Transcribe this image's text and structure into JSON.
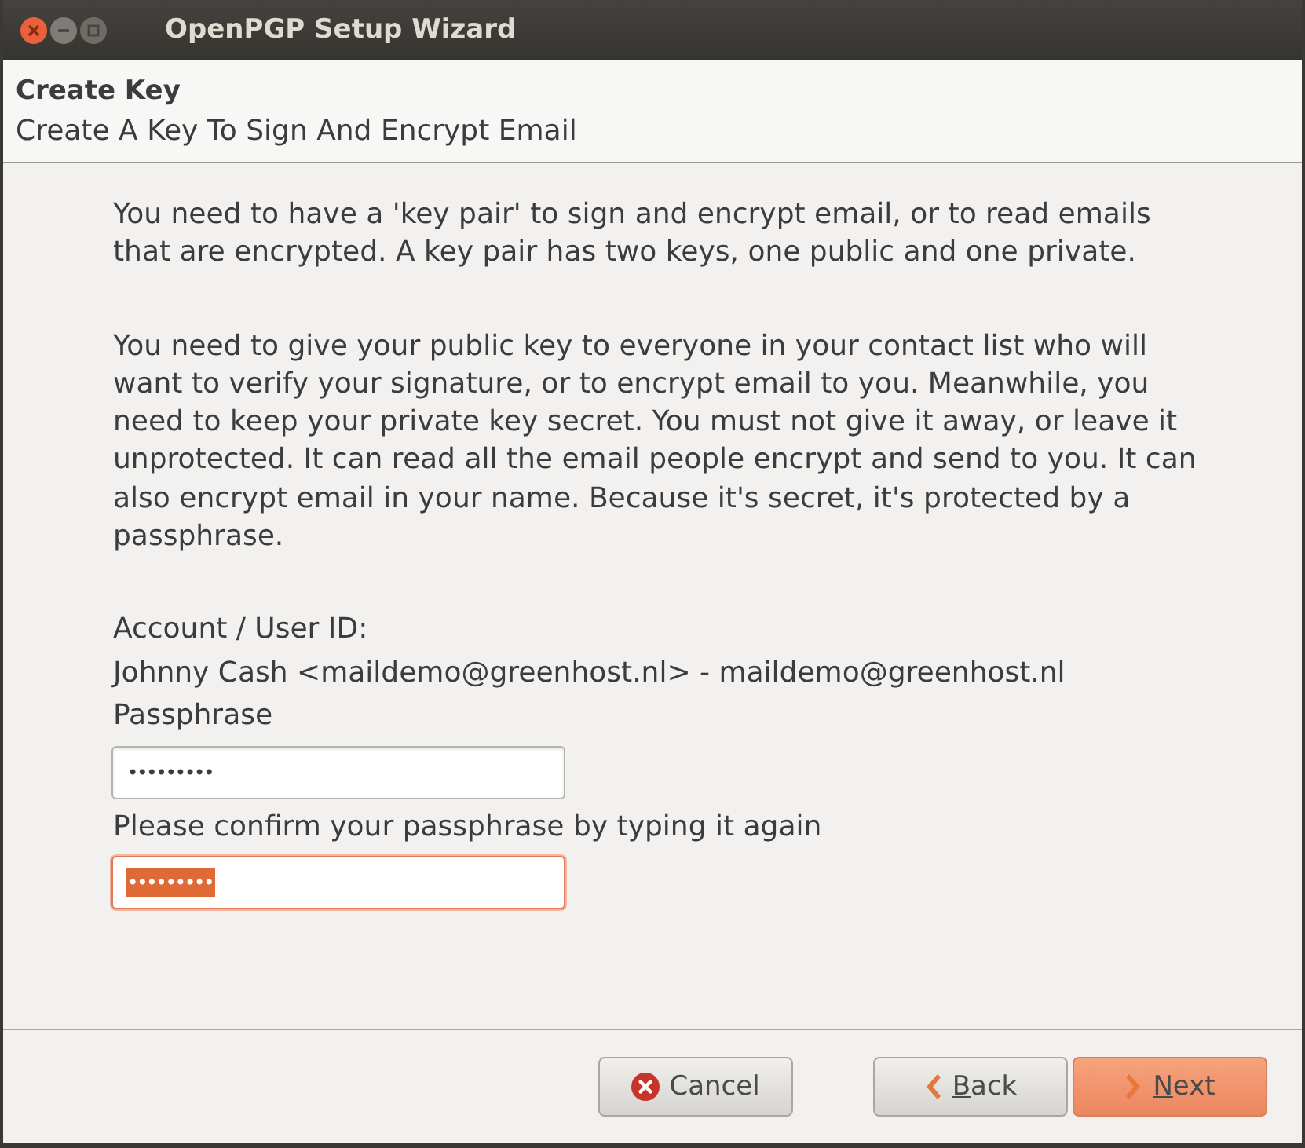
{
  "window": {
    "title": "OpenPGP Setup Wizard",
    "controls": [
      {
        "kind": "close"
      },
      {
        "kind": "minimize"
      },
      {
        "kind": "maximize"
      }
    ]
  },
  "header": {
    "title": "Create Key",
    "subtitle": "Create A Key To Sign And Encrypt Email"
  },
  "paragraphs": [
    "You need to have a 'key pair' to sign and encrypt email, or to read emails that are encrypted. A key pair has two keys, one public and one private.",
    "You need to give your public key to everyone in your contact list who will want to verify your signature, or to encrypt email to you. Meanwhile, you need to keep your private key secret. You must not give it away, or leave it unprotected. It can read all the email people encrypt and send to you. It can also encrypt email in your name. Because it's secret, it's protected by a passphrase."
  ],
  "account": {
    "label": "Account / User ID:",
    "value": "Johnny Cash <maildemo@greenhost.nl> - maildemo@greenhost.nl"
  },
  "fields": [
    {
      "label": "Passphrase",
      "value": "•••••••••",
      "focused": false,
      "text_selected": false
    },
    {
      "label": "Please confirm your passphrase by typing it again",
      "value": "•••••••••",
      "focused": true,
      "text_selected": true
    }
  ],
  "buttons": [
    {
      "kind": "cancel",
      "label": "Cancel",
      "mnemonic": false,
      "default": false
    },
    {
      "kind": "back",
      "label": "Back",
      "mnemonic": true,
      "default": false
    },
    {
      "kind": "next",
      "label": "Next",
      "mnemonic": true,
      "default": true
    }
  ]
}
